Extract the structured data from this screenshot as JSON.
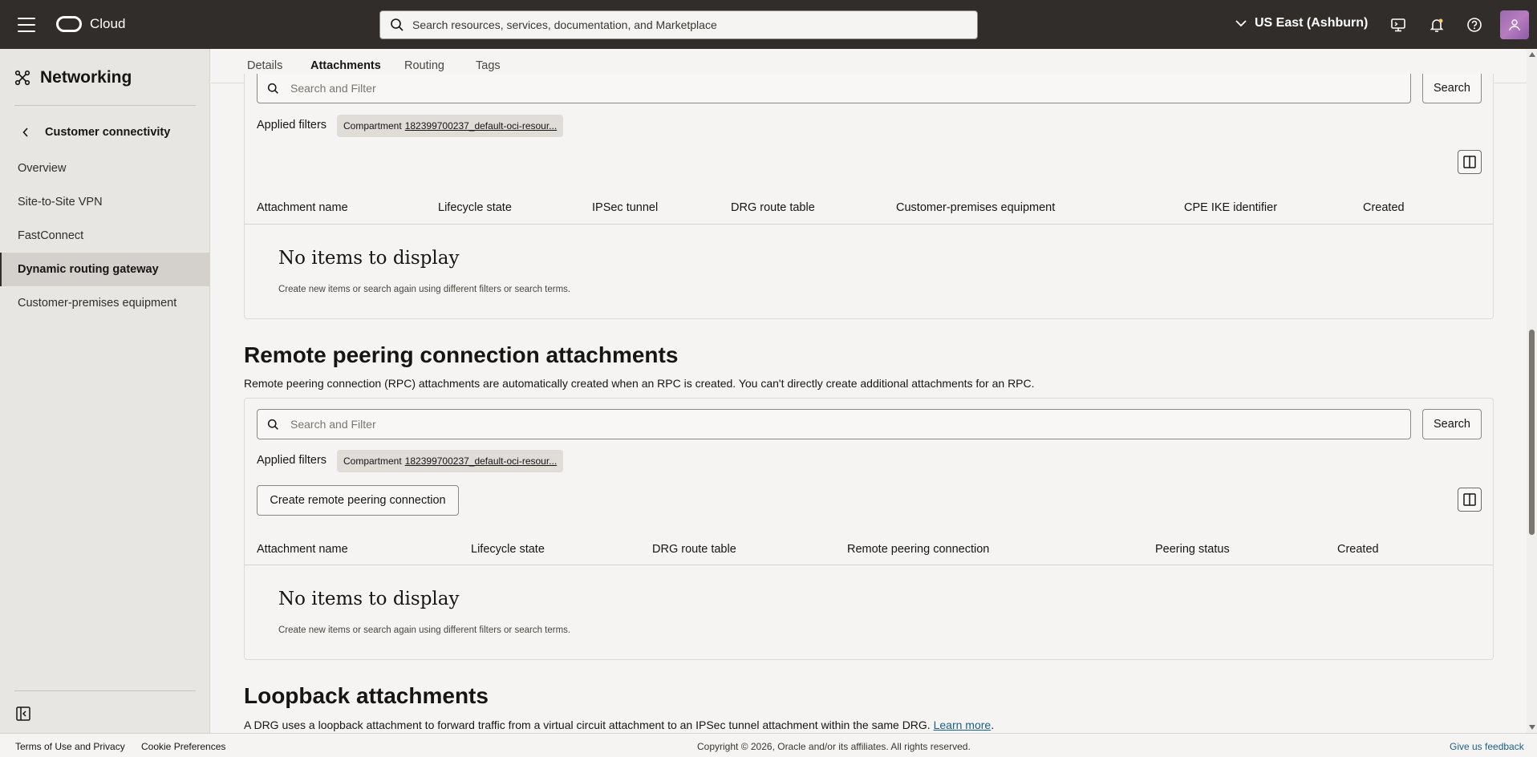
{
  "topbar": {
    "brand": "Cloud",
    "search_placeholder": "Search resources, services, documentation, and Marketplace",
    "region": "US East (Ashburn)"
  },
  "sidebar": {
    "title": "Networking",
    "back_label": "Customer connectivity",
    "items": [
      {
        "label": "Overview",
        "active": false
      },
      {
        "label": "Site-to-Site VPN",
        "active": false
      },
      {
        "label": "FastConnect",
        "active": false
      },
      {
        "label": "Dynamic routing gateway",
        "active": true
      },
      {
        "label": "Customer-premises equipment",
        "active": false
      }
    ]
  },
  "tabs": [
    "Details",
    "Attachments",
    "Routing",
    "Tags"
  ],
  "active_tab": "Attachments",
  "ipsec_section": {
    "filter_placeholder": "Search and Filter",
    "search_button": "Search",
    "applied_filters_label": "Applied filters",
    "chip_label": "Compartment",
    "chip_value": "182399700237_default-oci-resour...",
    "columns": [
      "Attachment name",
      "Lifecycle state",
      "IPSec tunnel",
      "DRG route table",
      "Customer-premises equipment",
      "CPE IKE identifier",
      "Created"
    ],
    "empty_title": "No items to display",
    "empty_sub": "Create new items or search again using different filters or search terms."
  },
  "rpc_section": {
    "title": "Remote peering connection attachments",
    "description": "Remote peering connection (RPC) attachments are automatically created when an RPC is created. You can't directly create additional attachments for an RPC.",
    "filter_placeholder": "Search and Filter",
    "search_button": "Search",
    "applied_filters_label": "Applied filters",
    "chip_label": "Compartment",
    "chip_value": "182399700237_default-oci-resour...",
    "create_button": "Create remote peering connection",
    "columns": [
      "Attachment name",
      "Lifecycle state",
      "DRG route table",
      "Remote peering connection",
      "Peering status",
      "Created"
    ],
    "empty_title": "No items to display",
    "empty_sub": "Create new items or search again using different filters or search terms."
  },
  "loopback_section": {
    "title": "Loopback attachments",
    "description": "A DRG uses a loopback attachment to forward traffic from a virtual circuit attachment to an IPSec tunnel attachment within the same DRG.",
    "learn_more": "Learn more",
    "period": "."
  },
  "footer": {
    "terms": "Terms of Use and Privacy",
    "cookies": "Cookie Preferences",
    "copyright": "Copyright © 2026, Oracle and/or its affiliates. All rights reserved.",
    "feedback": "Give us feedback"
  },
  "colors": {
    "topbar": "#312d2a",
    "sidebar": "#e8e6e3",
    "page": "#f5f4f2",
    "link": "#1a5f8a"
  }
}
